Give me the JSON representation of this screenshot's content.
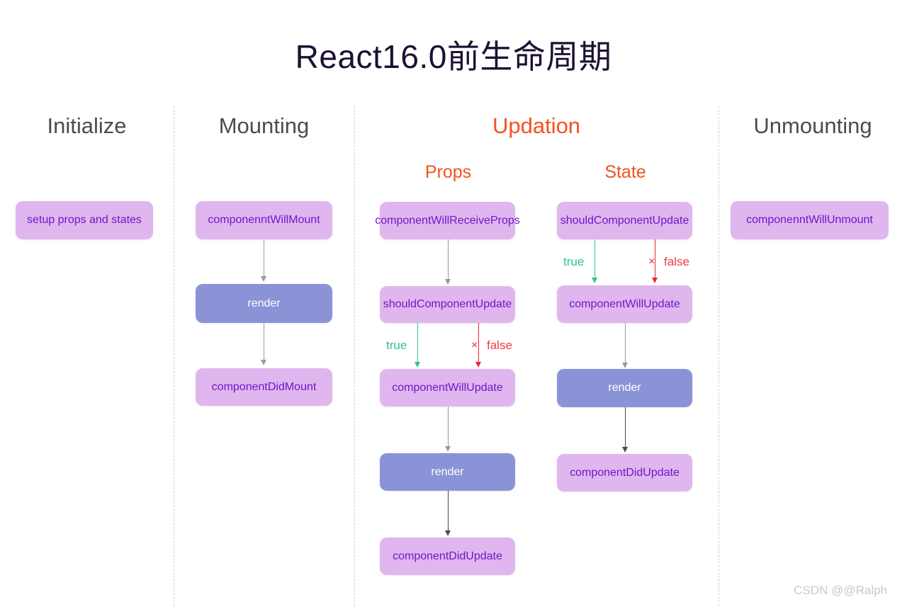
{
  "title": "React16.0前生命周期",
  "watermark": "CSDN @@Ralph",
  "colors": {
    "title": "#1c1033",
    "header": "#4c4c4c",
    "accent": "#f4511e",
    "node_purple_bg": "#e0b6ef",
    "node_purple_text": "#6f16c9",
    "node_blue_bg": "#8b93d7",
    "node_blue_text": "#ffffff",
    "true_branch": "#2fc48a",
    "false_branch": "#e8272c",
    "connector": "#9a9a9a",
    "divider": "#cfcfcf",
    "watermark": "#c9c9c9"
  },
  "columns": {
    "initialize": {
      "header": "Initialize",
      "nodes": [
        {
          "label": "setup props and states",
          "kind": "purple"
        }
      ]
    },
    "mounting": {
      "header": "Mounting",
      "nodes": [
        {
          "label": "componenntWillMount",
          "kind": "purple"
        },
        {
          "label": "render",
          "kind": "blue"
        },
        {
          "label": "componentDidMount",
          "kind": "purple"
        }
      ]
    },
    "updation": {
      "header": "Updation",
      "props": {
        "header": "Props",
        "nodes": [
          {
            "label": "componentWillReceiveProps",
            "kind": "purple"
          },
          {
            "label": "shouldComponentUpdate",
            "kind": "purple"
          },
          {
            "label": "componentWillUpdate",
            "kind": "purple"
          },
          {
            "label": "render",
            "kind": "blue"
          },
          {
            "label": "componentDidUpdate",
            "kind": "purple"
          }
        ],
        "branches": {
          "true_label": "true",
          "false_label": "false",
          "false_marker": "×"
        }
      },
      "state": {
        "header": "State",
        "nodes": [
          {
            "label": "shouldComponentUpdate",
            "kind": "purple"
          },
          {
            "label": "componentWillUpdate",
            "kind": "purple"
          },
          {
            "label": "render",
            "kind": "blue"
          },
          {
            "label": "componentDidUpdate",
            "kind": "purple"
          }
        ],
        "branches": {
          "true_label": "true",
          "false_label": "false",
          "false_marker": "×"
        }
      }
    },
    "unmounting": {
      "header": "Unmounting",
      "nodes": [
        {
          "label": "componenntWillUnmount",
          "kind": "purple"
        }
      ]
    }
  }
}
